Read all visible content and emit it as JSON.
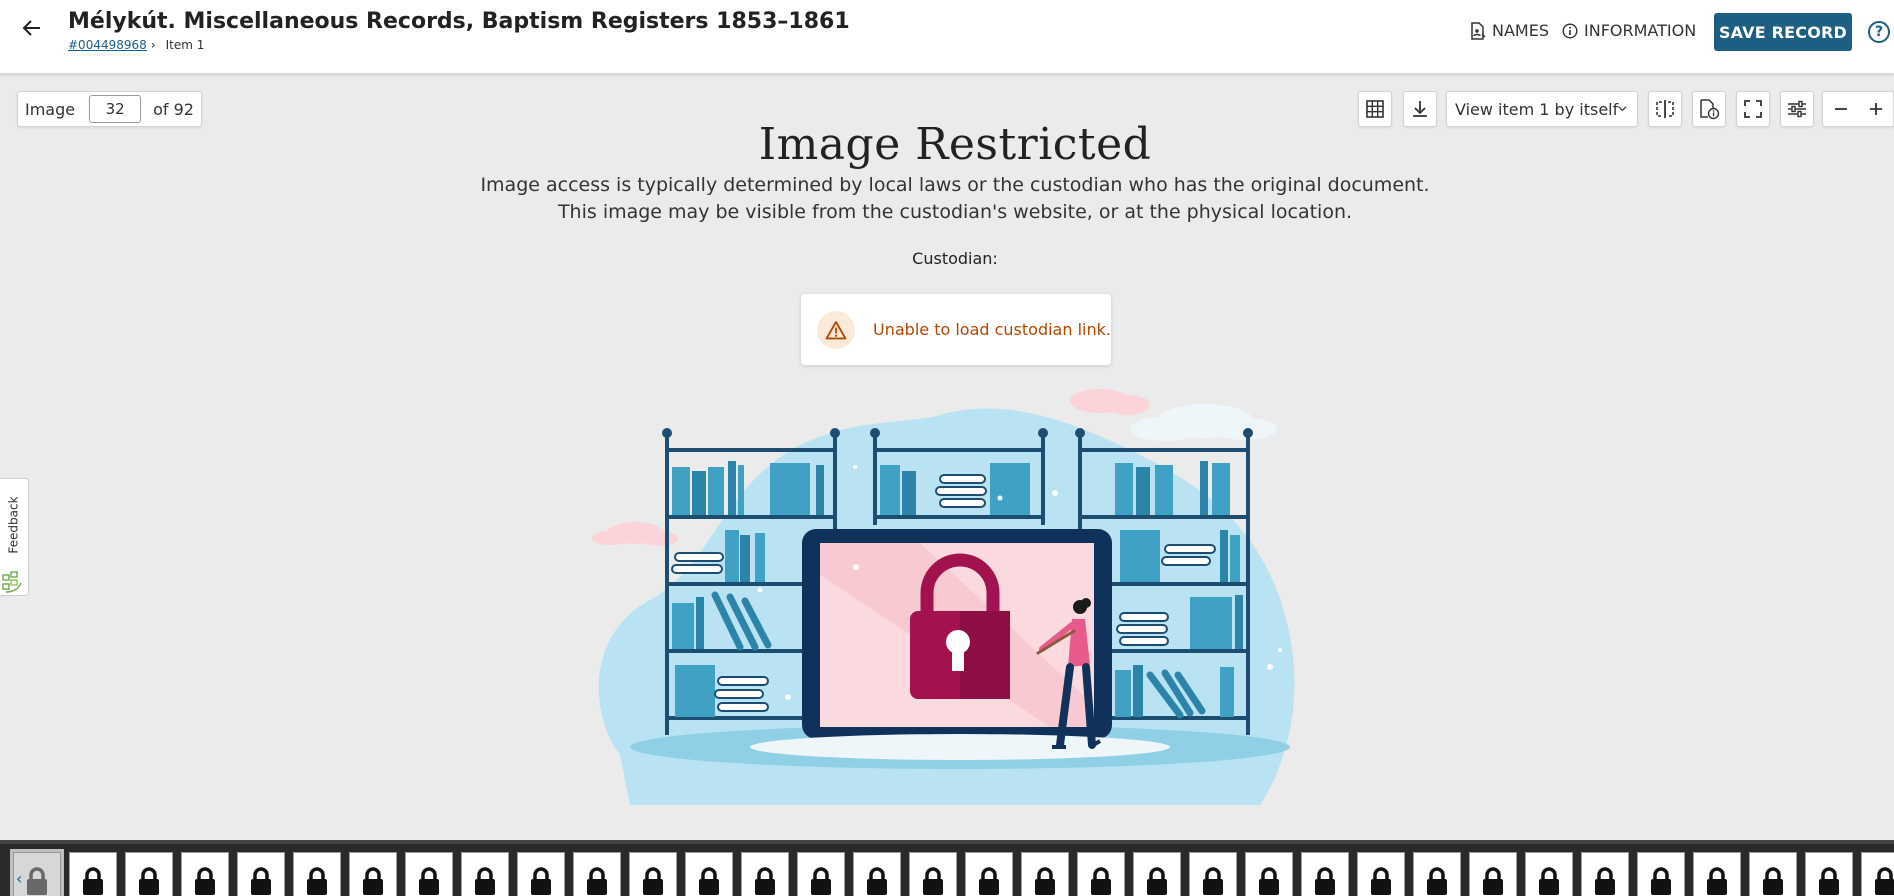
{
  "header": {
    "title": "Mélykút. Miscellaneous Records, Baptism Registers 1853–1861",
    "breadcrumb_id": "#004498968",
    "breadcrumb_sep": "›",
    "breadcrumb_item": "Item 1",
    "names_label": "NAMES",
    "information_label": "INFORMATION",
    "save_label": "SAVE RECORD",
    "help_label": "?"
  },
  "viewer": {
    "image_label": "Image",
    "image_number": "32",
    "image_total": "of 92",
    "view_option": "View item 1 by itself"
  },
  "restricted": {
    "title": "Image Restricted",
    "description": "Image access is typically determined by local laws or the custodian who has the original document. This image may be visible from the custodian's website, or at the physical location.",
    "custodian_label": "Custodian:",
    "error_message": "Unable to load custodian link."
  },
  "feedback": {
    "label": "Feedback"
  },
  "filmstrip": {
    "current_index": 0,
    "thumbnail_count": 34,
    "thumbnail_icon": "lock-icon"
  },
  "colors": {
    "brand": "#1d5f82",
    "error": "#b34700",
    "lock": "#a3124f",
    "illustration_blue": "#b9e3f2"
  }
}
